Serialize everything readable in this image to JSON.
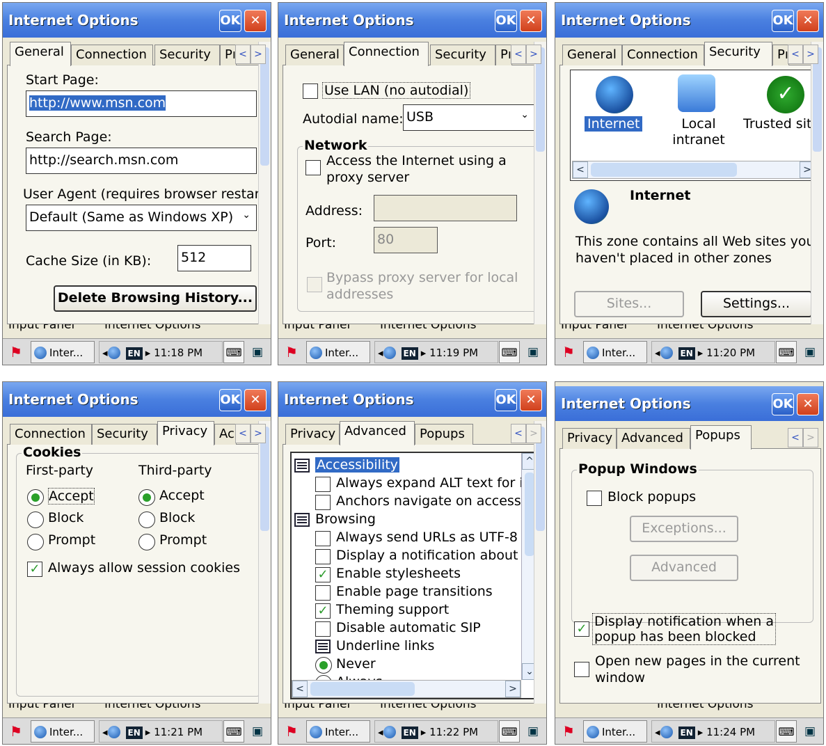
{
  "window_title": "Internet Options",
  "ok_label": "OK",
  "close_label": "✕",
  "taskbar": {
    "start_icon": "windows-flag-icon",
    "task_label": "Inter...",
    "lang": "EN",
    "keyboard_icon": "keyboard-icon",
    "desktop_icon": "desktop-icon"
  },
  "bottom_clip": {
    "left": "Input Panel",
    "right": "Internet Options"
  },
  "panels": [
    {
      "time": "11:18 PM",
      "tabs": [
        "General",
        "Connection",
        "Security",
        "Pı"
      ],
      "general": {
        "start_page_label": "Start Page:",
        "start_page_value": "http://www.msn.com",
        "search_page_label": "Search Page:",
        "search_page_value": "http://search.msn.com",
        "user_agent_label": "User Agent (requires browser restart):",
        "user_agent_value": "Default (Same as Windows XP)",
        "cache_label": "Cache Size (in KB):",
        "cache_value": "512",
        "delete_button": "Delete Browsing History..."
      }
    },
    {
      "time": "11:19 PM",
      "tabs": [
        "General",
        "Connection",
        "Security",
        "Pı"
      ],
      "connection": {
        "use_lan_label": "Use LAN (no autodial)",
        "autodial_label": "Autodial name:",
        "autodial_value": "USB",
        "network_group": "Network",
        "proxy_label_1": "Access the Internet using a",
        "proxy_label_2": "proxy server",
        "address_label": "Address:",
        "address_value": "",
        "port_label": "Port:",
        "port_value": "80",
        "bypass_label_1": "Bypass proxy server for local",
        "bypass_label_2": "addresses"
      }
    },
    {
      "time": "11:20 PM",
      "tabs": [
        "General",
        "Connection",
        "Security",
        "Pı"
      ],
      "security": {
        "zones": [
          "Internet",
          "Local intranet",
          "Trusted site"
        ],
        "zone_title": "Internet",
        "zone_desc_1": "This zone contains all Web sites you",
        "zone_desc_2": "haven't placed in other zones",
        "sites_button": "Sites...",
        "settings_button": "Settings..."
      }
    },
    {
      "time": "11:21 PM",
      "tabs": [
        "Connection",
        "Security",
        "Privacy",
        "Ac"
      ],
      "privacy": {
        "cookies_group": "Cookies",
        "first_party": "First-party",
        "third_party": "Third-party",
        "options": [
          "Accept",
          "Block",
          "Prompt"
        ],
        "first_selected": "Accept",
        "third_selected": "Accept",
        "session_label": "Always allow session cookies",
        "session_checked": true
      }
    },
    {
      "time": "11:22 PM",
      "tabs": [
        "Privacy",
        "Advanced",
        "Popups"
      ],
      "advanced": {
        "items": [
          {
            "text": "Accessibility",
            "type": "group",
            "selected": true
          },
          {
            "text": "Always expand ALT text for i",
            "type": "check",
            "checked": false
          },
          {
            "text": "Anchors navigate on access k",
            "type": "check",
            "checked": false
          },
          {
            "text": "Browsing",
            "type": "group",
            "selected": false
          },
          {
            "text": "Always send URLs as UTF-8",
            "type": "check",
            "checked": false
          },
          {
            "text": "Display a notification about e",
            "type": "check",
            "checked": false
          },
          {
            "text": "Enable stylesheets",
            "type": "check",
            "checked": true
          },
          {
            "text": "Enable page transitions",
            "type": "check",
            "checked": false
          },
          {
            "text": "Theming support",
            "type": "check",
            "checked": true
          },
          {
            "text": "Disable automatic SIP",
            "type": "check",
            "checked": false
          },
          {
            "text": "Underline links",
            "type": "group",
            "selected": false
          },
          {
            "text": "Never",
            "type": "radio",
            "checked": true
          },
          {
            "text": "Always",
            "type": "radio",
            "checked": false
          }
        ]
      }
    },
    {
      "time": "11:24 PM",
      "tabs": [
        "Privacy",
        "Advanced",
        "Popups"
      ],
      "popups": {
        "group": "Popup Windows",
        "block_label": "Block popups",
        "exceptions_button": "Exceptions...",
        "advanced_button": "Advanced",
        "notify_label_1": "Display notification when a",
        "notify_label_2": "popup has been blocked",
        "open_label_1": "Open new pages in the current",
        "open_label_2": "window"
      }
    }
  ]
}
